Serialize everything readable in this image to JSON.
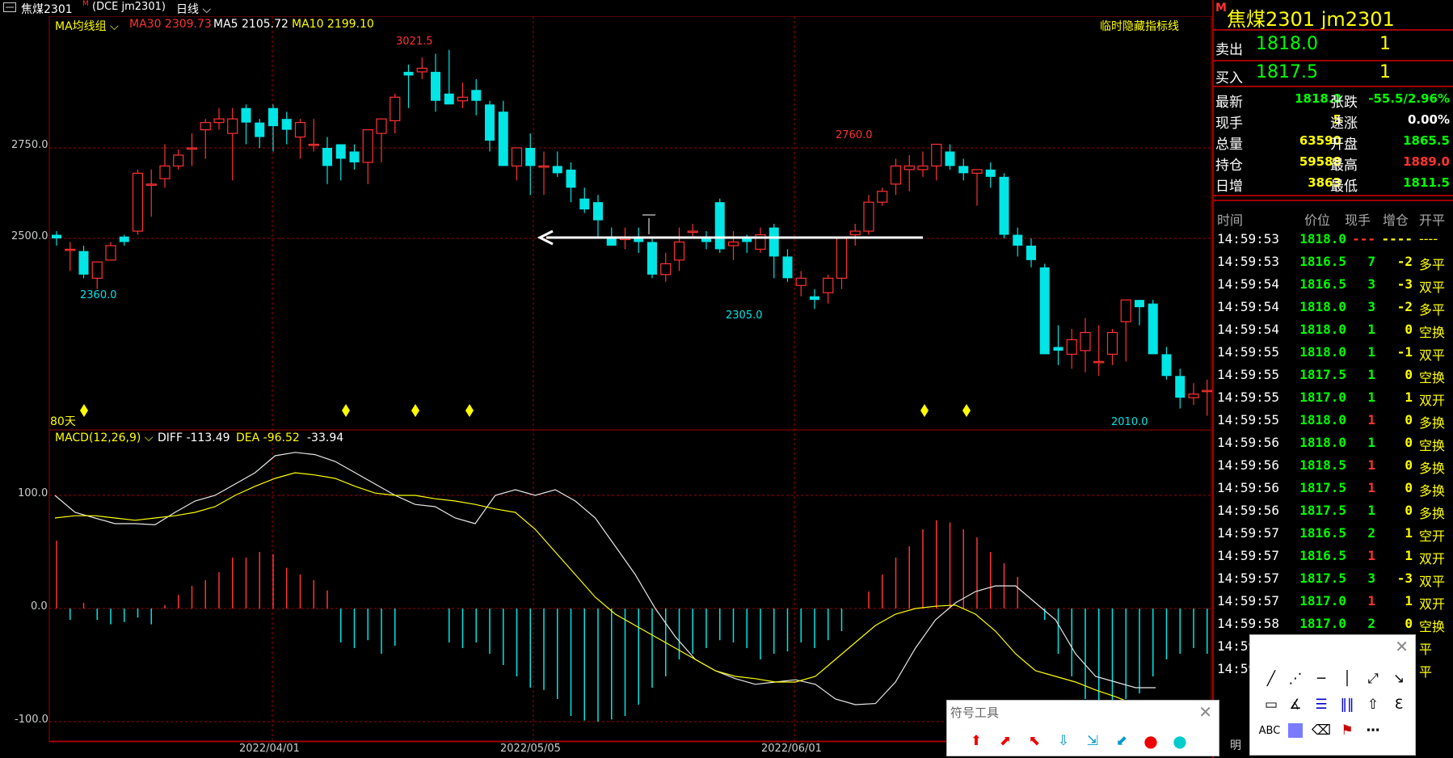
{
  "header": {
    "window_icon": "window-icon",
    "instrument": "焦煤2301",
    "code": "(DCE jm2301)",
    "period": "日线"
  },
  "ma_legend": {
    "group": "MA均线组",
    "ma30": "MA30 2309.73",
    "ma5": "MA5 2105.72",
    "ma10": "MA10 2199.10",
    "hide_indicator": "临时隐藏指标线"
  },
  "price_axis": {
    "ticks": [
      "2750.0",
      "2500.0"
    ]
  },
  "price_labels": {
    "high": "3021.5",
    "low1": "2360.0",
    "mid_low": "2305.0",
    "mid_high": "2760.0",
    "low2": "2010.0",
    "days": "80天"
  },
  "macd_legend": {
    "name": "MACD(12,26,9)",
    "diff": "DIFF -113.49",
    "dea": "DEA -96.52",
    "macd": "-33.94"
  },
  "macd_axis": {
    "ticks": [
      "100.0",
      "0.0",
      "-100.0"
    ]
  },
  "date_axis": {
    "ticks": [
      "2022/04/01",
      "2022/05/05",
      "2022/06/01"
    ]
  },
  "chart_data": {
    "type": "candlestick",
    "candles": [
      [
        2510,
        2520,
        2480,
        2500
      ],
      [
        2470,
        2490,
        2410,
        2470
      ],
      [
        2465,
        2480,
        2390,
        2400
      ],
      [
        2390,
        2420,
        2360,
        2435
      ],
      [
        2440,
        2490,
        2440,
        2480
      ],
      [
        2505,
        2510,
        2480,
        2490
      ],
      [
        2520,
        2690,
        2510,
        2680
      ],
      [
        2650,
        2690,
        2560,
        2650
      ],
      [
        2665,
        2760,
        2640,
        2700
      ],
      [
        2700,
        2745,
        2690,
        2730
      ],
      [
        2750,
        2790,
        2700,
        2750
      ],
      [
        2800,
        2830,
        2720,
        2820
      ],
      [
        2820,
        2860,
        2800,
        2830
      ],
      [
        2790,
        2860,
        2660,
        2830
      ],
      [
        2860,
        2870,
        2760,
        2820
      ],
      [
        2820,
        2830,
        2750,
        2780
      ],
      [
        2860,
        2870,
        2740,
        2810
      ],
      [
        2830,
        2850,
        2760,
        2800
      ],
      [
        2780,
        2830,
        2720,
        2820
      ],
      [
        2760,
        2830,
        2740,
        2760
      ],
      [
        2750,
        2780,
        2650,
        2700
      ],
      [
        2760,
        2760,
        2660,
        2720
      ],
      [
        2740,
        2760,
        2690,
        2710
      ],
      [
        2710,
        2790,
        2650,
        2800
      ],
      [
        2790,
        2820,
        2710,
        2830
      ],
      [
        2825,
        2900,
        2790,
        2890
      ],
      [
        2960,
        2980,
        2860,
        2950
      ],
      [
        2960,
        3000,
        2940,
        2970
      ],
      [
        2960,
        3010,
        2850,
        2880
      ],
      [
        2900,
        3021,
        2870,
        2870
      ],
      [
        2880,
        2930,
        2860,
        2890
      ],
      [
        2910,
        2940,
        2840,
        2880
      ],
      [
        2870,
        2880,
        2740,
        2770
      ],
      [
        2850,
        2880,
        2740,
        2700
      ],
      [
        2700,
        2740,
        2660,
        2750
      ],
      [
        2750,
        2790,
        2620,
        2700
      ],
      [
        2700,
        2740,
        2620,
        2700
      ],
      [
        2700,
        2740,
        2670,
        2680
      ],
      [
        2690,
        2710,
        2600,
        2640
      ],
      [
        2610,
        2640,
        2570,
        2580
      ],
      [
        2600,
        2620,
        2500,
        2550
      ],
      [
        2500,
        2530,
        2480,
        2480
      ],
      [
        2500,
        2530,
        2470,
        2500
      ],
      [
        2500,
        2530,
        2460,
        2490
      ],
      [
        2490,
        2500,
        2390,
        2400
      ],
      [
        2400,
        2460,
        2380,
        2430
      ],
      [
        2440,
        2530,
        2410,
        2490
      ],
      [
        2520,
        2540,
        2500,
        2520
      ],
      [
        2500,
        2520,
        2470,
        2490
      ],
      [
        2600,
        2610,
        2460,
        2470
      ],
      [
        2480,
        2520,
        2440,
        2490
      ],
      [
        2500,
        2510,
        2460,
        2490
      ],
      [
        2470,
        2530,
        2460,
        2510
      ],
      [
        2530,
        2540,
        2390,
        2450
      ],
      [
        2450,
        2470,
        2380,
        2390
      ],
      [
        2370,
        2410,
        2340,
        2390
      ],
      [
        2340,
        2360,
        2305,
        2330
      ],
      [
        2350,
        2400,
        2320,
        2390
      ],
      [
        2390,
        2500,
        2360,
        2500
      ],
      [
        2510,
        2540,
        2480,
        2520
      ],
      [
        2520,
        2620,
        2510,
        2600
      ],
      [
        2600,
        2640,
        2590,
        2630
      ],
      [
        2650,
        2720,
        2620,
        2700
      ],
      [
        2690,
        2730,
        2630,
        2700
      ],
      [
        2690,
        2740,
        2670,
        2700
      ],
      [
        2700,
        2760,
        2660,
        2760
      ],
      [
        2740,
        2760,
        2690,
        2700
      ],
      [
        2700,
        2720,
        2660,
        2680
      ],
      [
        2680,
        2690,
        2590,
        2690
      ],
      [
        2690,
        2710,
        2640,
        2670
      ],
      [
        2670,
        2680,
        2500,
        2510
      ],
      [
        2510,
        2530,
        2450,
        2480
      ],
      [
        2480,
        2500,
        2420,
        2440
      ],
      [
        2420,
        2430,
        2180,
        2180
      ],
      [
        2200,
        2260,
        2150,
        2190
      ],
      [
        2180,
        2250,
        2140,
        2220
      ],
      [
        2190,
        2280,
        2130,
        2240
      ],
      [
        2160,
        2260,
        2120,
        2160
      ],
      [
        2180,
        2250,
        2150,
        2240
      ],
      [
        2270,
        2330,
        2160,
        2330
      ],
      [
        2330,
        2330,
        2260,
        2310
      ],
      [
        2320,
        2330,
        2190,
        2180
      ],
      [
        2180,
        2200,
        2110,
        2120
      ],
      [
        2120,
        2140,
        2030,
        2060
      ],
      [
        2060,
        2100,
        2040,
        2070
      ],
      [
        2080,
        2110,
        2010,
        2080
      ],
      [
        2080,
        2150,
        2050,
        2060
      ]
    ]
  },
  "quote": {
    "badge": "M",
    "title": "焦煤2301  jm2301",
    "sell_label": "卖出",
    "sell_price": "1818.0",
    "sell_qty": "1",
    "buy_label": "买入",
    "buy_price": "1817.5",
    "buy_qty": "1",
    "stats": [
      {
        "l1": "最新",
        "v1": "1818.0",
        "l2": "张跌",
        "v2": "-55.5/2.96%"
      },
      {
        "l1": "现手",
        "v1": "5",
        "l2": "速涨",
        "v2": "0.00%"
      },
      {
        "l1": "总量",
        "v1": "63590",
        "l2": "开盘",
        "v2": "1865.5"
      },
      {
        "l1": "持仓",
        "v1": "59588",
        "l2": "最高",
        "v2": "1889.0"
      },
      {
        "l1": "日增",
        "v1": "3863",
        "l2": "最低",
        "v2": "1811.5"
      }
    ],
    "tick_headers": [
      "时间",
      "价位",
      "现手",
      "增仓",
      "开平"
    ],
    "ticks": [
      {
        "t": "14:59:53",
        "p": "1818.0",
        "q": "---",
        "d": "----",
        "k": "----"
      },
      {
        "t": "14:59:53",
        "p": "1816.5",
        "q": "7",
        "d": "-2",
        "k": "多平"
      },
      {
        "t": "14:59:54",
        "p": "1816.5",
        "q": "3",
        "d": "-3",
        "k": "双平"
      },
      {
        "t": "14:59:54",
        "p": "1818.0",
        "q": "3",
        "d": "-2",
        "k": "多平"
      },
      {
        "t": "14:59:54",
        "p": "1818.0",
        "q": "1",
        "d": "0",
        "k": "空换"
      },
      {
        "t": "14:59:55",
        "p": "1818.0",
        "q": "1",
        "d": "-1",
        "k": "双平"
      },
      {
        "t": "14:59:55",
        "p": "1817.5",
        "q": "1",
        "d": "0",
        "k": "空换"
      },
      {
        "t": "14:59:55",
        "p": "1817.0",
        "q": "1",
        "d": "1",
        "k": "双开"
      },
      {
        "t": "14:59:55",
        "p": "1818.0",
        "q": "1",
        "d": "0",
        "k": "多换"
      },
      {
        "t": "14:59:56",
        "p": "1818.0",
        "q": "1",
        "d": "0",
        "k": "空换"
      },
      {
        "t": "14:59:56",
        "p": "1818.5",
        "q": "1",
        "d": "0",
        "k": "多换"
      },
      {
        "t": "14:59:56",
        "p": "1817.5",
        "q": "1",
        "d": "0",
        "k": "多换"
      },
      {
        "t": "14:59:56",
        "p": "1817.5",
        "q": "1",
        "d": "0",
        "k": "多换"
      },
      {
        "t": "14:59:57",
        "p": "1816.5",
        "q": "2",
        "d": "1",
        "k": "空开"
      },
      {
        "t": "14:59:57",
        "p": "1816.5",
        "q": "1",
        "d": "1",
        "k": "双开"
      },
      {
        "t": "14:59:57",
        "p": "1817.5",
        "q": "3",
        "d": "-3",
        "k": "双平"
      },
      {
        "t": "14:59:57",
        "p": "1817.0",
        "q": "1",
        "d": "1",
        "k": "双开"
      },
      {
        "t": "14:59:58",
        "p": "1817.0",
        "q": "2",
        "d": "0",
        "k": "空换"
      },
      {
        "t": "14:59",
        "p": "",
        "q": "",
        "d": "",
        "k": "平"
      },
      {
        "t": "14:59",
        "p": "",
        "q": "",
        "d": "",
        "k": "平"
      }
    ],
    "bottom_tab": "明"
  },
  "symbol_panel": {
    "title": "符号工具"
  },
  "draw_panel": {
    "abc": "ABC"
  },
  "colors": {
    "up": "#ff3232",
    "down": "#00e5e5",
    "grid": "#a00000",
    "yellow": "#ffff00",
    "green": "#00ff00"
  }
}
